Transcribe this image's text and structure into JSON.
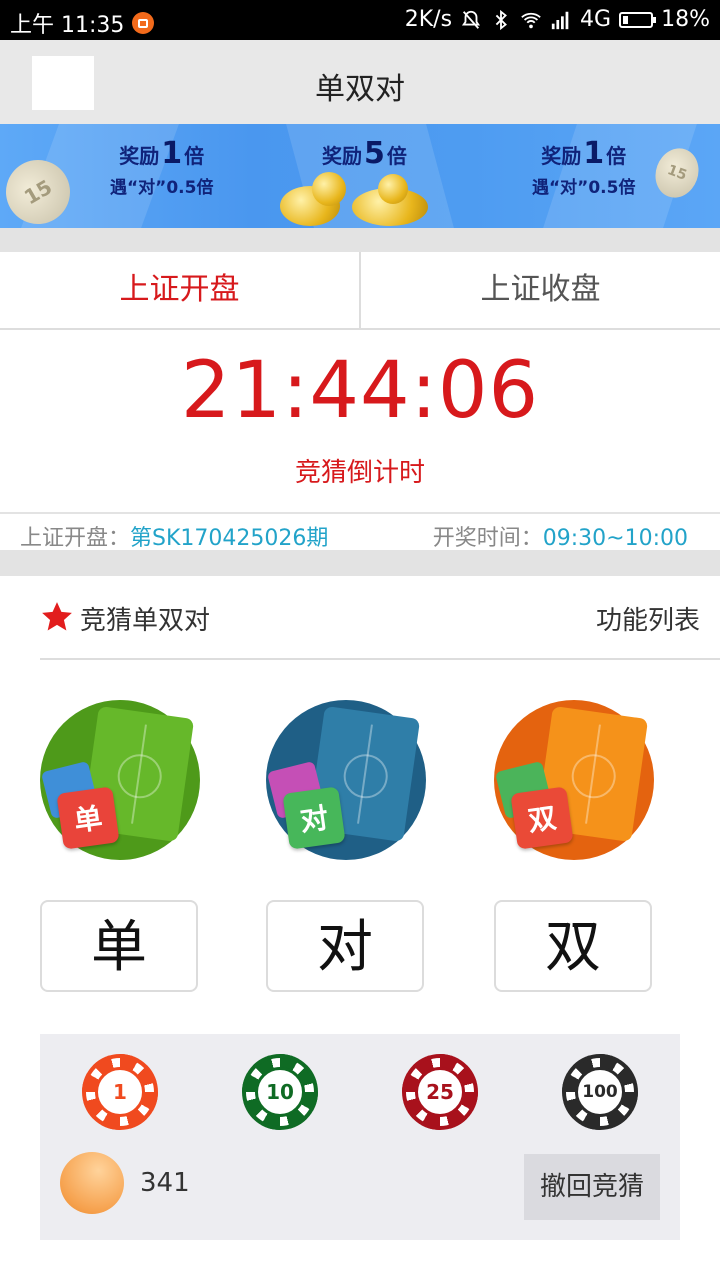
{
  "status_bar": {
    "time": "上午 11:35",
    "net_speed": "2K/s",
    "network": "4G",
    "battery": "18%",
    "battery_level": 0.18
  },
  "nav": {
    "title": "单双对"
  },
  "banner": {
    "left": {
      "reward_prefix": "奖励",
      "multiplier": "1",
      "reward_suffix": "倍",
      "note": "遇“对”0.5倍",
      "coin_text": "15"
    },
    "center": {
      "reward_prefix": "奖励",
      "multiplier": "5",
      "reward_suffix": "倍"
    },
    "right": {
      "reward_prefix": "奖励",
      "multiplier": "1",
      "reward_suffix": "倍",
      "note": "遇“对”0.5倍",
      "coin_text": "15"
    }
  },
  "tabs": [
    {
      "label": "上证开盘",
      "active": true
    },
    {
      "label": "上证收盘",
      "active": false
    }
  ],
  "countdown": {
    "time": "21:44:06",
    "label": "竞猜倒计时"
  },
  "period": {
    "market_label": "上证开盘：",
    "period_id": "第SK170425026期",
    "draw_label": "开奖时间：",
    "draw_time": "09:30~10:00"
  },
  "guess": {
    "title": "竞猜单双对",
    "function_list": "功能列表",
    "options": [
      {
        "label": "单",
        "icon_text": "单",
        "colors": {
          "circle": "#4e9a1a",
          "field": "#66b82a",
          "card": "#e9443a",
          "back": "#3f8fd8"
        }
      },
      {
        "label": "对",
        "icon_text": "对",
        "colors": {
          "circle": "#1f5f86",
          "field": "#2f7ea8",
          "card": "#47b75a",
          "back": "#c54fb6"
        }
      },
      {
        "label": "双",
        "icon_text": "双",
        "colors": {
          "circle": "#e4630f",
          "field": "#f5921a",
          "card": "#ea4a37",
          "back": "#4bb45a"
        }
      }
    ]
  },
  "chips": [
    {
      "value": "1",
      "color": "#f04a1f",
      "text_color": "#f04a1f"
    },
    {
      "value": "10",
      "color": "#0f6b24",
      "text_color": "#0f6b24"
    },
    {
      "value": "25",
      "color": "#a8111c",
      "text_color": "#a8111c"
    },
    {
      "value": "100",
      "color": "#2a2a2a",
      "text_color": "#2a2a2a"
    }
  ],
  "account": {
    "balance": "341",
    "withdraw_label": "撤回竞猜"
  }
}
